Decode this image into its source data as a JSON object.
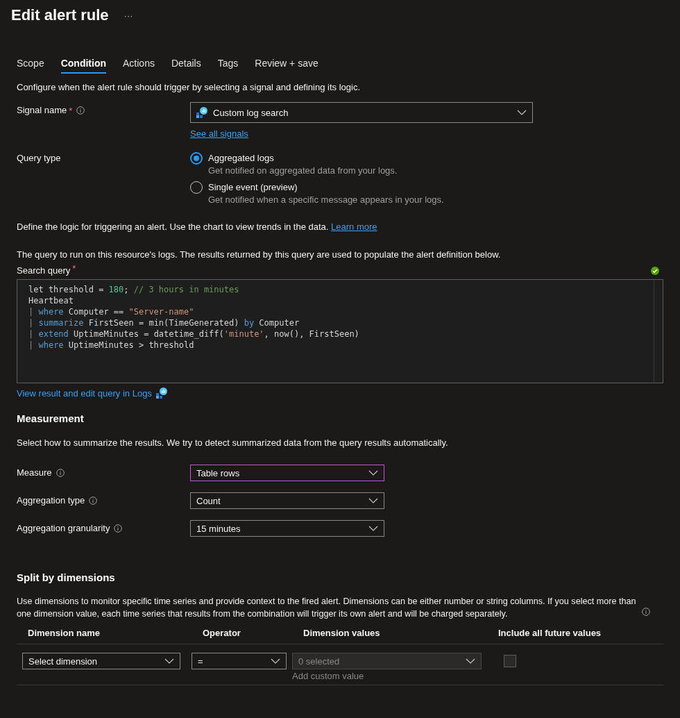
{
  "title": "Edit alert rule",
  "more": "···",
  "tabs": [
    {
      "label": "Scope",
      "selected": false
    },
    {
      "label": "Condition",
      "selected": true
    },
    {
      "label": "Actions",
      "selected": false
    },
    {
      "label": "Details",
      "selected": false
    },
    {
      "label": "Tags",
      "selected": false
    },
    {
      "label": "Review + save",
      "selected": false
    }
  ],
  "intro": "Configure when the alert rule should trigger by selecting a signal and defining its logic.",
  "signal": {
    "label": "Signal name",
    "required_mark": "*",
    "value": "Custom log search",
    "link": "See all signals"
  },
  "query_type": {
    "label": "Query type",
    "options": [
      {
        "label": "Aggregated logs",
        "hint": "Get notified on aggregated data from your logs.",
        "selected": true
      },
      {
        "label": "Single event (preview)",
        "hint": "Get notified when a specific message appears in your logs.",
        "selected": false
      }
    ]
  },
  "logic_text": "Define the logic for triggering an alert. Use the chart to view trends in the data.",
  "logic_link": "Learn more",
  "query_intro": "The query to run on this resource's logs. The results returned by this query are used to populate the alert definition below.",
  "search_query": {
    "label": "Search query",
    "required_mark": "*",
    "valid": true,
    "lines": [
      [
        {
          "kind": "plain",
          "text": "let threshold = "
        },
        {
          "kind": "number",
          "text": "180"
        },
        {
          "kind": "plain",
          "text": "; "
        },
        {
          "kind": "comment",
          "text": "// 3 hours in minutes"
        }
      ],
      [
        {
          "kind": "plain",
          "text": "Heartbeat"
        }
      ],
      [
        {
          "kind": "pipe",
          "text": "| "
        },
        {
          "kind": "keyword",
          "text": "where"
        },
        {
          "kind": "plain",
          "text": " Computer == "
        },
        {
          "kind": "string",
          "text": "\"Server-name\""
        }
      ],
      [
        {
          "kind": "pipe",
          "text": "| "
        },
        {
          "kind": "keyword",
          "text": "summarize"
        },
        {
          "kind": "plain",
          "text": " FirstSeen = min(TimeGenerated) "
        },
        {
          "kind": "keyword",
          "text": "by"
        },
        {
          "kind": "plain",
          "text": " Computer"
        }
      ],
      [
        {
          "kind": "pipe",
          "text": "| "
        },
        {
          "kind": "keyword",
          "text": "extend"
        },
        {
          "kind": "plain",
          "text": " UptimeMinutes = datetime_diff("
        },
        {
          "kind": "string",
          "text": "'minute'"
        },
        {
          "kind": "plain",
          "text": ", now(), FirstSeen)"
        }
      ],
      [
        {
          "kind": "pipe",
          "text": "| "
        },
        {
          "kind": "keyword",
          "text": "where"
        },
        {
          "kind": "plain",
          "text": " UptimeMinutes > threshold"
        }
      ]
    ]
  },
  "logs_link": "View result and edit query in Logs",
  "measurement": {
    "heading": "Measurement",
    "description": "Select how to summarize the results. We try to detect summarized data from the query results automatically.",
    "fields": [
      {
        "label": "Measure",
        "value": "Table rows",
        "focused": true
      },
      {
        "label": "Aggregation type",
        "value": "Count",
        "focused": false
      },
      {
        "label": "Aggregation granularity",
        "value": "15 minutes",
        "focused": false
      }
    ]
  },
  "split": {
    "heading": "Split by dimensions",
    "description": "Use dimensions to monitor specific time series and provide context to the fired alert. Dimensions can be either number or string columns. If you select more than one dimension value, each time series that results from the combination will trigger its own alert and will be charged separately.",
    "columns": [
      "Dimension name",
      "Operator",
      "Dimension values",
      "Include all future values"
    ],
    "row": {
      "dimension": "Select dimension",
      "operator": "=",
      "values_placeholder": "0 selected",
      "values_disabled": true,
      "custom_placeholder": "Add custom value",
      "include_future": false
    }
  }
}
